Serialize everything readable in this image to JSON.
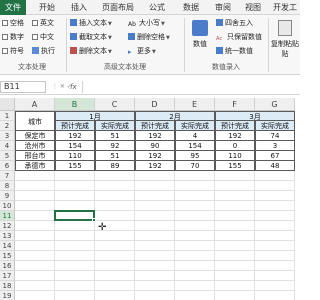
{
  "tabs": [
    "文件",
    "开始",
    "插入",
    "页面布局",
    "公式",
    "数据",
    "审阅",
    "视图",
    "开发工"
  ],
  "ribbon": {
    "group1": {
      "items": [
        "空格",
        "英文",
        "数字",
        "中文",
        "符号",
        "执行"
      ],
      "label": "文本处理"
    },
    "group2": {
      "items": [
        "插入文本",
        "截取文本",
        "删除文本",
        "大小写",
        "删除空格",
        "更多"
      ],
      "label": "高级文本处理"
    },
    "group3": {
      "big_button": "数值",
      "items": [
        "四舍五入",
        "只保留数值",
        "统一数值"
      ],
      "label": "数值录入"
    },
    "group4": {
      "big_button": "复制粘贴",
      "sub": "贴"
    }
  },
  "formula_bar": {
    "name_box": "B11",
    "fx": "fx",
    "value": ""
  },
  "sheet": {
    "columns": [
      "A",
      "B",
      "C",
      "D",
      "E",
      "F",
      "G"
    ],
    "rows": [
      "1",
      "2",
      "3",
      "4",
      "5",
      "6",
      "7",
      "8",
      "9",
      "10",
      "11",
      "12",
      "13",
      "14",
      "15",
      "16",
      "17",
      "18",
      "19"
    ],
    "header_merge": {
      "city": "城市",
      "months": [
        "1月",
        "2月",
        "3月"
      ]
    },
    "subheaders": [
      "预计完成",
      "实际完成",
      "预计完成",
      "实际完成",
      "预计完成",
      "实际完成"
    ],
    "data": [
      [
        "保定市",
        "192",
        "51",
        "192",
        "4",
        "192",
        "74"
      ],
      [
        "沧州市",
        "154",
        "92",
        "90",
        "154",
        "0",
        "3"
      ],
      [
        "邢台市",
        "110",
        "51",
        "192",
        "95",
        "110",
        "67"
      ],
      [
        "承德市",
        "155",
        "89",
        "192",
        "70",
        "155",
        "48"
      ]
    ],
    "selected_cell": "B11"
  },
  "colors": {
    "accent": "#217346",
    "header_fill": "#ddebf7"
  }
}
